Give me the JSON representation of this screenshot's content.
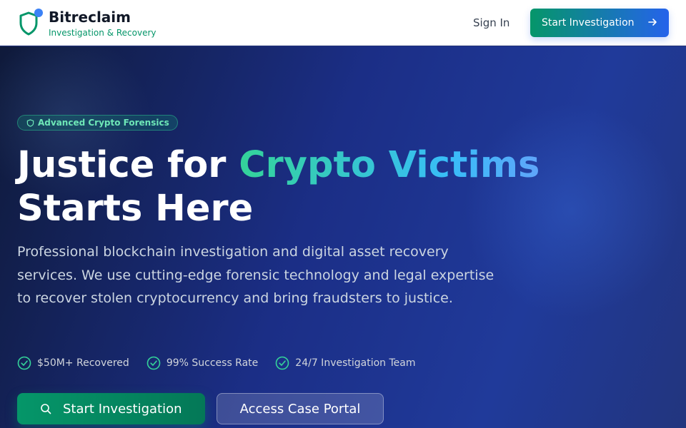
{
  "header": {
    "brand_name": "Bitreclaim",
    "brand_tagline": "Investigation & Recovery",
    "sign_in_label": "Sign In",
    "cta_label": "Start Investigation"
  },
  "hero": {
    "badge_label": "Advanced Crypto Forensics",
    "headline_part1": "Justice for ",
    "headline_highlight": "Crypto Victims",
    "headline_part2": " Starts Here",
    "description": "Professional blockchain investigation and digital asset recovery services. We use cutting-edge forensic technology and legal expertise to recover stolen cryptocurrency and bring fraudsters to justice.",
    "stats": [
      {
        "label": "$50M+ Recovered",
        "icon": "check-circle-icon"
      },
      {
        "label": "99% Success Rate",
        "icon": "check-circle-icon"
      },
      {
        "label": "24/7 Investigation Team",
        "icon": "check-circle-icon"
      }
    ],
    "primary_cta_label": "Start Investigation",
    "secondary_cta_label": "Access Case Portal"
  },
  "colors": {
    "brand_green": "#059669",
    "brand_blue": "#2563eb",
    "badge_text": "#6ee7b7",
    "header_bg": "#ffffff",
    "hero_bg": "#1b2e86"
  },
  "icons": {
    "logo": "shield-icon",
    "header_cta": "arrow-right-icon",
    "badge": "shield-icon",
    "primary_cta": "search-icon"
  }
}
